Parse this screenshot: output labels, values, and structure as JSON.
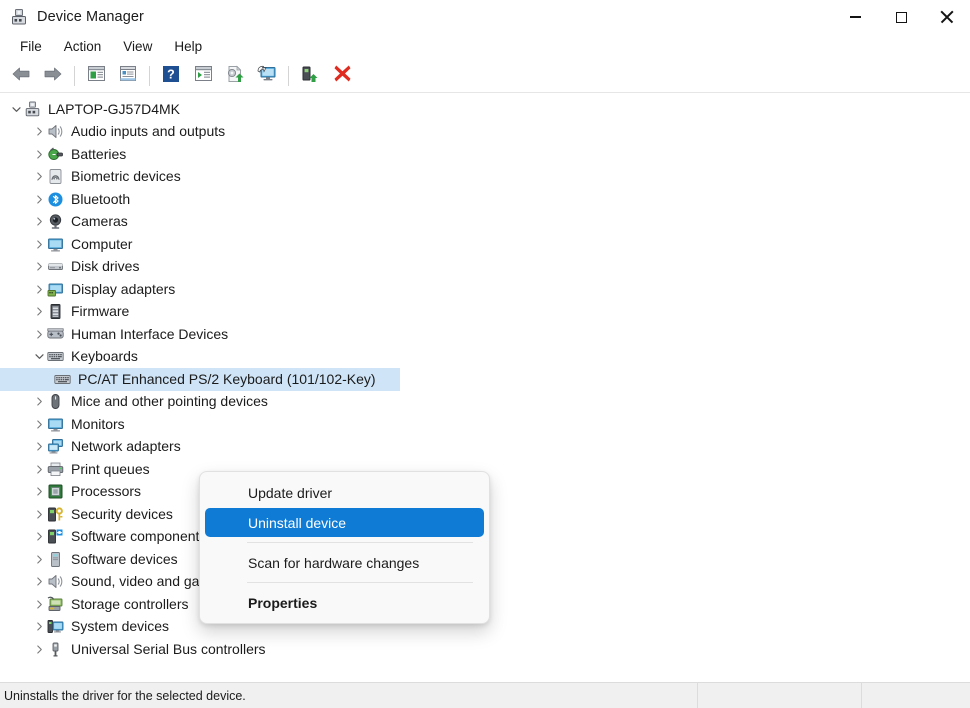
{
  "window": {
    "title": "Device Manager",
    "app_icon": "device-manager-icon",
    "controls": {
      "minimize": "minimize-icon",
      "maximize": "maximize-icon",
      "close": "close-icon"
    }
  },
  "menubar": {
    "items": [
      {
        "label": "File"
      },
      {
        "label": "Action"
      },
      {
        "label": "View"
      },
      {
        "label": "Help"
      }
    ]
  },
  "toolbar": {
    "buttons": [
      {
        "name": "back-button",
        "icon": "back-arrow-icon"
      },
      {
        "name": "forward-button",
        "icon": "forward-arrow-icon"
      },
      {
        "name": "separator-1",
        "icon": "separator"
      },
      {
        "name": "show-hide-console-tree-button",
        "icon": "console-tree-icon"
      },
      {
        "name": "properties-button",
        "icon": "properties-icon"
      },
      {
        "name": "separator-2",
        "icon": "separator"
      },
      {
        "name": "help-button",
        "icon": "help-question-icon"
      },
      {
        "name": "show-hide-action-pane-button",
        "icon": "action-pane-icon"
      },
      {
        "name": "update-driver-button",
        "icon": "update-driver-icon"
      },
      {
        "name": "scan-for-hardware-changes-button",
        "icon": "scan-monitor-icon"
      },
      {
        "name": "separator-3",
        "icon": "separator"
      },
      {
        "name": "enable-device-button",
        "icon": "enable-device-icon"
      },
      {
        "name": "uninstall-device-button",
        "icon": "red-x-icon"
      }
    ]
  },
  "tree": {
    "root": {
      "label": "LAPTOP-GJ57D4MK",
      "icon": "computer-device-icon",
      "expanded": true
    },
    "nodes": [
      {
        "label": "Audio inputs and outputs",
        "icon": "speaker-icon",
        "expanded": false,
        "selected": false
      },
      {
        "label": "Batteries",
        "icon": "battery-icon",
        "expanded": false,
        "selected": false
      },
      {
        "label": "Biometric devices",
        "icon": "fingerprint-icon",
        "expanded": false,
        "selected": false
      },
      {
        "label": "Bluetooth",
        "icon": "bluetooth-icon",
        "expanded": false,
        "selected": false
      },
      {
        "label": "Cameras",
        "icon": "camera-icon",
        "expanded": false,
        "selected": false
      },
      {
        "label": "Computer",
        "icon": "monitor-icon",
        "expanded": false,
        "selected": false
      },
      {
        "label": "Disk drives",
        "icon": "disk-drive-icon",
        "expanded": false,
        "selected": false
      },
      {
        "label": "Display adapters",
        "icon": "display-adapter-icon",
        "expanded": false,
        "selected": false
      },
      {
        "label": "Firmware",
        "icon": "firmware-chip-icon",
        "expanded": false,
        "selected": false
      },
      {
        "label": "Human Interface Devices",
        "icon": "hid-gamepad-icon",
        "expanded": false,
        "selected": false
      },
      {
        "label": "Keyboards",
        "icon": "keyboard-icon",
        "expanded": true,
        "selected": false
      },
      {
        "label": "PC/AT Enhanced PS/2 Keyboard (101/102-Key)",
        "icon": "keyboard-icon",
        "expanded": null,
        "selected": true,
        "child": true
      },
      {
        "label": "Mice and other pointing devices",
        "icon": "mouse-icon",
        "expanded": false,
        "selected": false
      },
      {
        "label": "Monitors",
        "icon": "monitor-icon",
        "expanded": false,
        "selected": false
      },
      {
        "label": "Network adapters",
        "icon": "network-adapter-icon",
        "expanded": false,
        "selected": false
      },
      {
        "label": "Print queues",
        "icon": "printer-icon",
        "expanded": false,
        "selected": false
      },
      {
        "label": "Processors",
        "icon": "processor-icon",
        "expanded": false,
        "selected": false
      },
      {
        "label": "Security devices",
        "icon": "security-key-icon",
        "expanded": false,
        "selected": false
      },
      {
        "label": "Software components",
        "icon": "software-component-icon",
        "expanded": false,
        "selected": false
      },
      {
        "label": "Software devices",
        "icon": "software-device-icon",
        "expanded": false,
        "selected": false
      },
      {
        "label": "Sound, video and game controllers",
        "icon": "speaker-icon",
        "expanded": false,
        "selected": false
      },
      {
        "label": "Storage controllers",
        "icon": "storage-controller-icon",
        "expanded": false,
        "selected": false
      },
      {
        "label": "System devices",
        "icon": "system-device-icon",
        "expanded": false,
        "selected": false
      },
      {
        "label": "Universal Serial Bus controllers",
        "icon": "usb-icon",
        "expanded": false,
        "selected": false
      }
    ]
  },
  "context_menu": {
    "items": [
      {
        "label": "Update driver",
        "highlighted": false,
        "bold": false
      },
      {
        "label": "Uninstall device",
        "highlighted": true,
        "bold": false
      },
      {
        "separator": true
      },
      {
        "label": "Scan for hardware changes",
        "highlighted": false,
        "bold": false
      },
      {
        "separator": true
      },
      {
        "label": "Properties",
        "highlighted": false,
        "bold": true
      }
    ]
  },
  "statusbar": {
    "message": "Uninstalls the driver for the selected device.",
    "pane2": "",
    "pane3": ""
  },
  "colors": {
    "accent": "#0f7bd4",
    "selection": "#cfe4f7",
    "status_bg": "#f0f0f0",
    "menu_bg": "#f9f9f9"
  }
}
